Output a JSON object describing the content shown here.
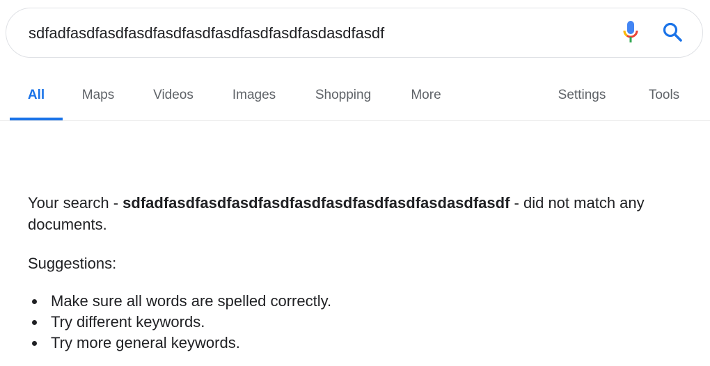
{
  "search": {
    "query": "sdfadfasdfasdfasdfasdfasdfasdfasdfasdfasdasdfasdf",
    "mic_icon": "microphone-icon",
    "search_icon": "magnifier-icon"
  },
  "tabs": [
    {
      "label": "All",
      "active": true
    },
    {
      "label": "Maps",
      "active": false
    },
    {
      "label": "Videos",
      "active": false
    },
    {
      "label": "Images",
      "active": false
    },
    {
      "label": "Shopping",
      "active": false
    },
    {
      "label": "More",
      "active": false
    },
    {
      "label": "Settings",
      "active": false
    },
    {
      "label": "Tools",
      "active": false
    }
  ],
  "results": {
    "prefix": "Your search - ",
    "query": "sdfadfasdfasdfasdfasdfasdfasdfasdfasdfasdasdfasdf",
    "suffix": " - did not match any documents.",
    "suggestions_heading": "Suggestions:",
    "suggestions": [
      "Make sure all words are spelled correctly.",
      "Try different keywords.",
      "Try more general keywords."
    ]
  },
  "colors": {
    "accent": "#1a73e8",
    "tab_text": "#5f6368",
    "text": "#202124",
    "mic_blue": "#4285f4",
    "mic_red": "#ea4335",
    "mic_yellow": "#fbbc05",
    "mic_green": "#34a853"
  }
}
